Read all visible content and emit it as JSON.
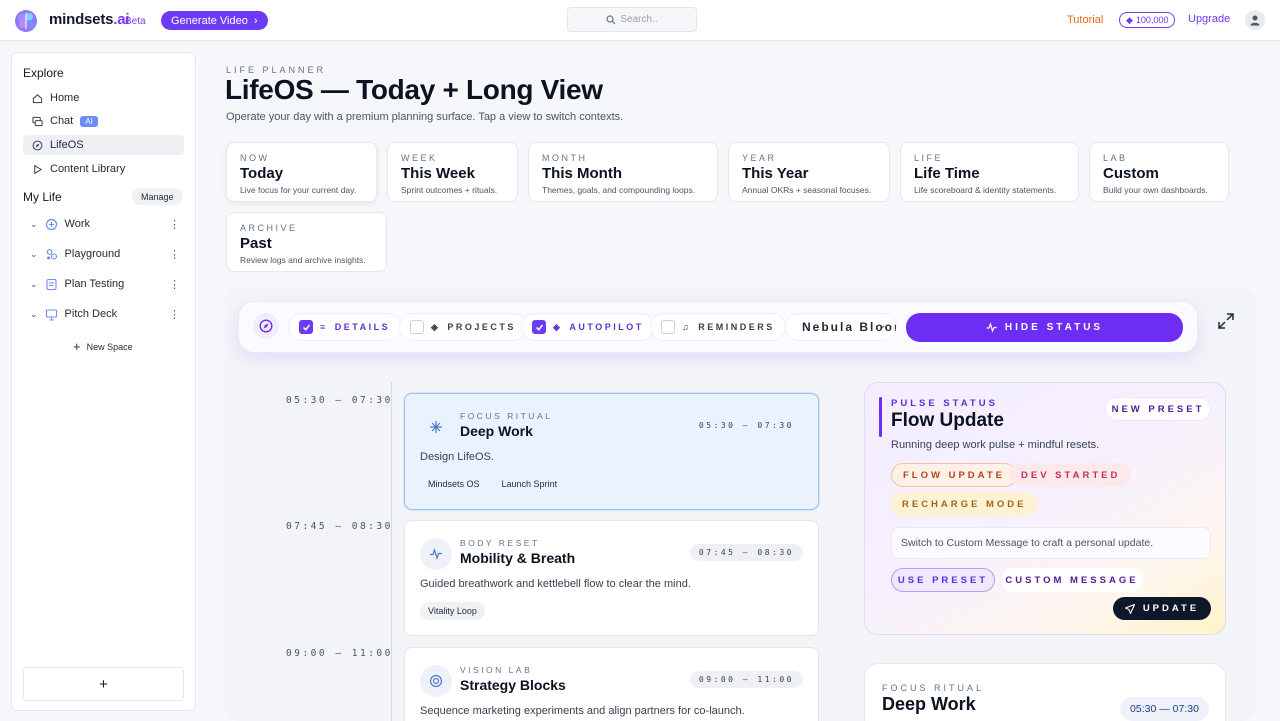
{
  "topbar": {
    "brand_name": "mindsets",
    "brand_suffix": ".ai",
    "beta": "Beta",
    "generate_label": "Generate Video",
    "search_placeholder": "Search..",
    "tutorial": "Tutorial",
    "credits": "100,000",
    "upgrade": "Upgrade"
  },
  "sidebar": {
    "explore": "Explore",
    "items": [
      {
        "label": "Home",
        "icon": "home-icon"
      },
      {
        "label": "Chat",
        "icon": "chat-icon",
        "badge": "AI"
      },
      {
        "label": "LifeOS",
        "icon": "compass-icon",
        "active": true
      },
      {
        "label": "Content Library",
        "icon": "play-icon"
      }
    ],
    "my_life": "My Life",
    "manage": "Manage",
    "spaces": [
      {
        "label": "Work",
        "icon": "work-icon"
      },
      {
        "label": "Playground",
        "icon": "playground-icon"
      },
      {
        "label": "Plan Testing",
        "icon": "plan-icon"
      },
      {
        "label": "Pitch Deck",
        "icon": "presentation-icon"
      }
    ],
    "new_space": "New Space",
    "add": "+"
  },
  "header": {
    "eyebrow": "LIFE PLANNER",
    "title": "LifeOS — Today + Long View",
    "subtitle": "Operate your day with a premium planning surface. Tap a view to switch contexts."
  },
  "views": [
    {
      "kicker": "NOW",
      "title": "Today",
      "desc": "Live focus for your current day."
    },
    {
      "kicker": "WEEK",
      "title": "This Week",
      "desc": "Sprint outcomes + rituals."
    },
    {
      "kicker": "MONTH",
      "title": "This Month",
      "desc": "Themes, goals, and compounding loops."
    },
    {
      "kicker": "YEAR",
      "title": "This Year",
      "desc": "Annual OKRs + seasonal focuses."
    },
    {
      "kicker": "LIFE",
      "title": "Life Time",
      "desc": "Life scoreboard & identity statements."
    },
    {
      "kicker": "LAB",
      "title": "Custom",
      "desc": "Build your own dashboards."
    },
    {
      "kicker": "ARCHIVE",
      "title": "Past",
      "desc": "Review logs and archive insights."
    }
  ],
  "toolbar": {
    "details": "DETAILS",
    "details_on": true,
    "projects": "PROJECTS",
    "projects_on": false,
    "autopilot": "AUTOPILOT",
    "autopilot_on": true,
    "reminders": "REMINDERS",
    "reminders_on": false,
    "theme": "Nebula Bloom",
    "hide_status": "HIDE STATUS"
  },
  "timeline": [
    {
      "time": "05:30 — 07:30",
      "kicker": "FOCUS RITUAL",
      "title": "Deep Work",
      "desc": "Design LifeOS.",
      "tags": [
        "Mindsets OS",
        "Launch Sprint"
      ]
    },
    {
      "time": "07:45 — 08:30",
      "kicker": "BODY RESET",
      "title": "Mobility & Breath",
      "desc": "Guided breathwork and kettlebell flow to clear the mind.",
      "tags": [
        "Vitality Loop"
      ]
    },
    {
      "time": "09:00 — 11:00",
      "kicker": "VISION LAB",
      "title": "Strategy Blocks",
      "desc": "Sequence marketing experiments and align partners for co-launch.",
      "tags": []
    }
  ],
  "pulse": {
    "kicker": "PULSE STATUS",
    "title": "Flow Update",
    "desc": "Running deep work pulse + mindful resets.",
    "new_preset": "NEW PRESET",
    "presets": [
      "FLOW UPDATE",
      "DEV STARTED",
      "RECHARGE MODE"
    ],
    "message": "Switch to Custom Message to craft a personal update.",
    "use_preset": "USE PRESET",
    "custom_message": "CUSTOM MESSAGE",
    "update": "UPDATE"
  },
  "mini": {
    "kicker": "FOCUS RITUAL",
    "title": "Deep Work",
    "time": "05:30 — 07:30"
  },
  "colors": {
    "accent": "#6d2df2",
    "tutorial": "#ea6c12",
    "ai_badge": "#6d8cf5"
  }
}
